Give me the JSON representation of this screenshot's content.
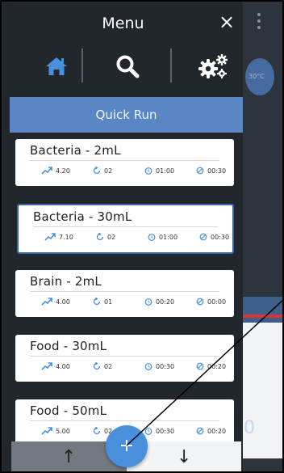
{
  "menu": {
    "title": "Menu",
    "close_label": "×"
  },
  "nav_icons": [
    "home-icon",
    "search-icon",
    "settings-gears-icon"
  ],
  "quick_run": {
    "label": "Quick Run"
  },
  "programs": [
    {
      "name": "Bacteria - 2mL",
      "speed": "4.20",
      "cycles": "02",
      "duration": "01:00",
      "pause": "00:30"
    },
    {
      "name": "Bacteria - 30mL",
      "speed": "7.10",
      "cycles": "02",
      "duration": "01:00",
      "pause": "00:30",
      "selected": true
    },
    {
      "name": "Brain - 2mL",
      "speed": "4.00",
      "cycles": "01",
      "duration": "00:20",
      "pause": "00:00"
    },
    {
      "name": "Food - 30mL",
      "speed": "4.00",
      "cycles": "02",
      "duration": "00:30",
      "pause": "00:20"
    },
    {
      "name": "Food - 50mL",
      "speed": "5.00",
      "cycles": "02",
      "duration": "00:30",
      "pause": "00:20"
    }
  ],
  "bottom_bar": {
    "up_label": "↑",
    "down_label": "↓"
  },
  "fab": {
    "label": "+"
  },
  "background": {
    "zero_value": "0",
    "badge_text": "30°C"
  },
  "colors": {
    "accent": "#5a86c6",
    "fab": "#4a8fdb",
    "drawer": "#22272e",
    "selected_border": "#3a67a8"
  }
}
